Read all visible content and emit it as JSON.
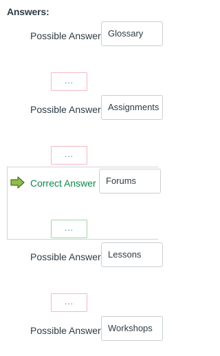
{
  "heading": "Answers:",
  "answers": [
    {
      "label": "Possible Answer",
      "value": "Glossary",
      "type": "possible"
    },
    {
      "label": "Possible Answer",
      "value": "Assignments",
      "type": "possible"
    },
    {
      "label": "Correct Answer",
      "value": "Forums",
      "type": "correct"
    },
    {
      "label": "Possible Answer",
      "value": "Lessons",
      "type": "possible"
    },
    {
      "label": "Possible Answer",
      "value": "Workshops",
      "type": "possible"
    }
  ],
  "comment_button": "...",
  "colors": {
    "correct_text": "#0b874b",
    "comment_border_possible": "#f4b8c1",
    "comment_border_correct": "#9fd4a7",
    "arrow_fill": "#8ebd4a"
  },
  "icons": {
    "correct_marker": "arrow-right-icon"
  }
}
